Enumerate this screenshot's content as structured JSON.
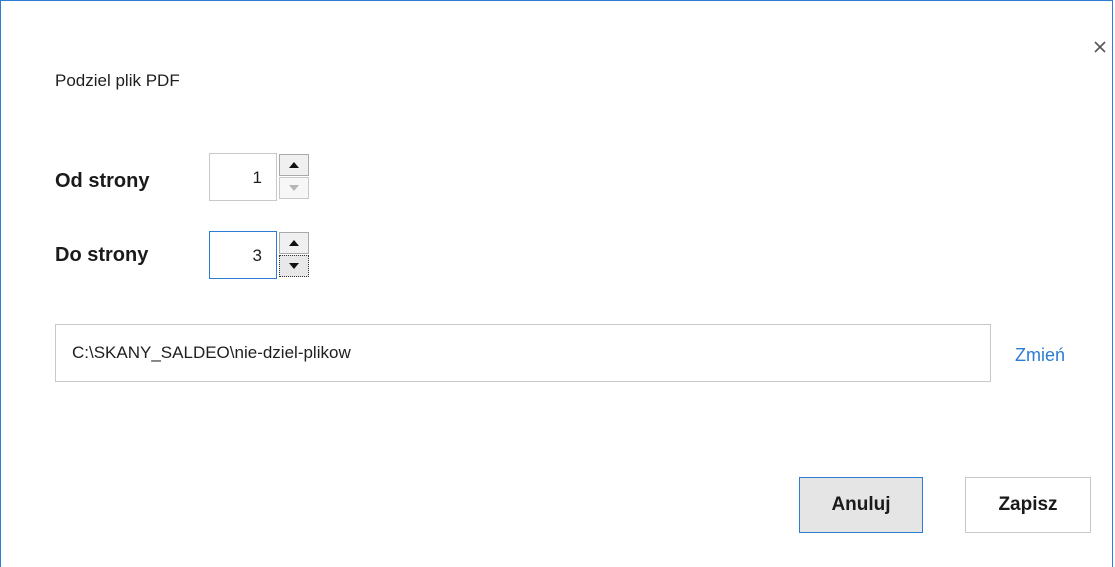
{
  "dialog": {
    "title": "Podziel plik PDF",
    "close_icon": "close-icon"
  },
  "range": {
    "from_label": "Od strony",
    "from_value": "1",
    "to_label": "Do strony",
    "to_value": "3"
  },
  "path": {
    "value": "C:\\SKANY_SALDEO\\nie-dziel-plikow",
    "change_label": "Zmień"
  },
  "buttons": {
    "cancel_label": "Anuluj",
    "save_label": "Zapisz"
  },
  "colors": {
    "accent": "#2b7cd3",
    "border": "#c8c8c8",
    "button_bg": "#e5e5e5"
  }
}
